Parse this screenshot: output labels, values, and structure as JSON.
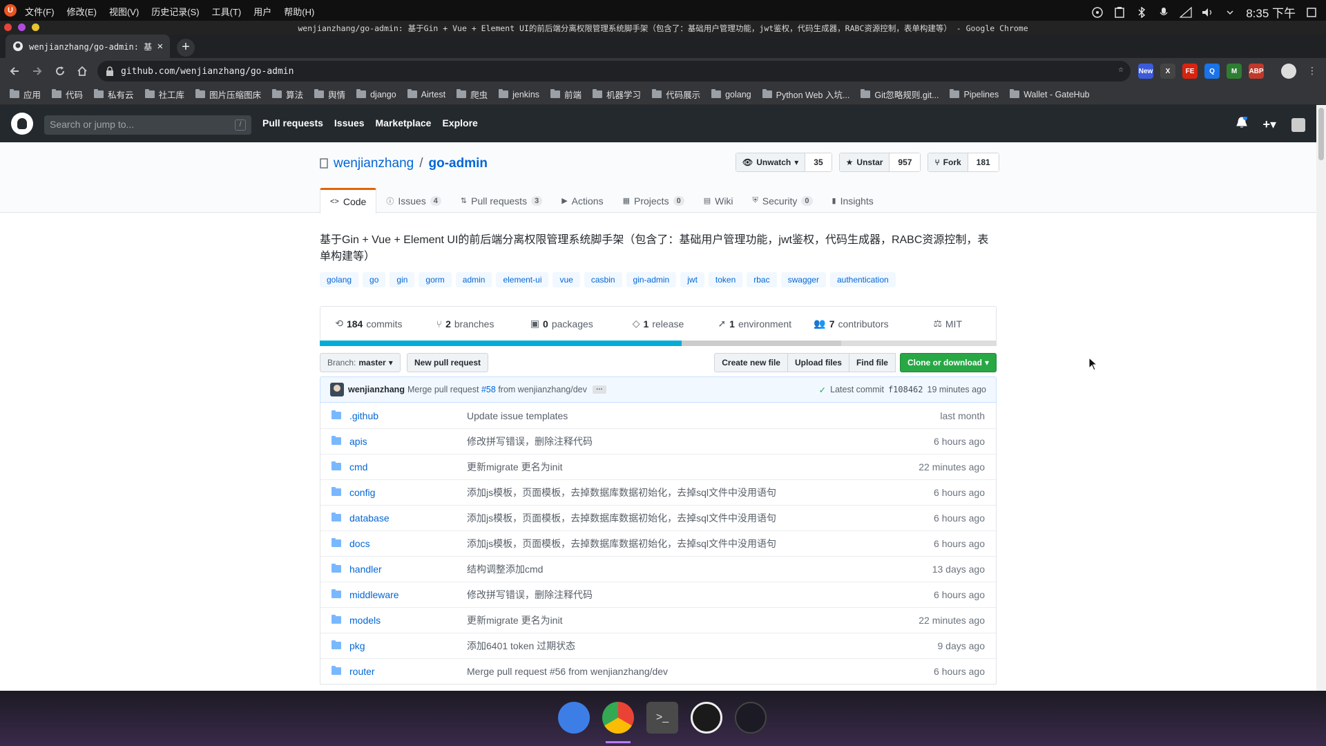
{
  "os": {
    "logo": "U",
    "menus": [
      "文件(F)",
      "修改(E)",
      "视图(V)",
      "历史记录(S)",
      "工具(T)",
      "用户",
      "帮助(H)"
    ],
    "clock": "8:35 下午"
  },
  "window": {
    "title": "wenjianzhang/go-admin: 基于Gin + Vue + Element UI的前后端分离权限管理系统脚手架（包含了：基础用户管理功能，jwt鉴权，代码生成器，RABC资源控制，表单构建等） - Google Chrome"
  },
  "browser": {
    "tab_title": "wenjianzhang/go-admin: 基",
    "url": "github.com/wenjianzhang/go-admin",
    "extensions": [
      {
        "label": "New",
        "color": "#3b5bdb"
      },
      {
        "label": "X",
        "color": "#444"
      },
      {
        "label": "FE",
        "color": "#d9230f"
      },
      {
        "label": "Q",
        "color": "#1a73e8"
      },
      {
        "label": "M",
        "color": "#2e7d32"
      },
      {
        "label": "ABP",
        "color": "#c0392b"
      }
    ],
    "bookmarks": [
      "应用",
      "代码",
      "私有云",
      "社工库",
      "图片压缩图床",
      "算法",
      "舆情",
      "django",
      "Airtest",
      "爬虫",
      "jenkins",
      "前端",
      "机器学习",
      "代码展示",
      "golang",
      "Python Web 入坑...",
      "Git忽略规则.git...",
      "Pipelines",
      "Wallet - GateHub"
    ]
  },
  "github": {
    "search_placeholder": "Search or jump to...",
    "search_key": "/",
    "nav": [
      "Pull requests",
      "Issues",
      "Marketplace",
      "Explore"
    ],
    "owner": "wenjianzhang",
    "repo": "go-admin",
    "watch": {
      "label": "Unwatch",
      "count": "35"
    },
    "star": {
      "label": "Unstar",
      "count": "957"
    },
    "fork": {
      "label": "Fork",
      "count": "181"
    },
    "tabs": [
      {
        "label": "Code",
        "count": ""
      },
      {
        "label": "Issues",
        "count": "4"
      },
      {
        "label": "Pull requests",
        "count": "3"
      },
      {
        "label": "Actions",
        "count": ""
      },
      {
        "label": "Projects",
        "count": "0"
      },
      {
        "label": "Wiki",
        "count": ""
      },
      {
        "label": "Security",
        "count": "0"
      },
      {
        "label": "Insights",
        "count": ""
      }
    ],
    "description": "基于Gin + Vue + Element UI的前后端分离权限管理系统脚手架（包含了：基础用户管理功能，jwt鉴权，代码生成器，RABC资源控制，表单构建等）",
    "topics": [
      "golang",
      "go",
      "gin",
      "gorm",
      "admin",
      "element-ui",
      "vue",
      "casbin",
      "gin-admin",
      "jwt",
      "token",
      "rbac",
      "swagger",
      "authentication"
    ],
    "summary": {
      "commits": "184",
      "commits_label": "commits",
      "branches": "2",
      "branches_label": "branches",
      "packages": "0",
      "packages_label": "packages",
      "releases": "1",
      "releases_label": "release",
      "environments": "1",
      "environments_label": "environment",
      "contributors": "7",
      "contributors_label": "contributors",
      "license": "MIT"
    },
    "language_bar": [
      {
        "share": 0.535,
        "color": "#00ADD8"
      },
      {
        "share": 0.235,
        "color": "#cccccc"
      },
      {
        "share": 0.23,
        "color": "#dddddd"
      }
    ],
    "branch_label": "Branch:",
    "branch": "master",
    "new_pr": "New pull request",
    "file_buttons": [
      "Create new file",
      "Upload files",
      "Find file"
    ],
    "clone_label": "Clone or download",
    "commit": {
      "author": "wenjianzhang",
      "message_prefix": "Merge pull request",
      "pr": "#58",
      "message_suffix": "from wenjianzhang/dev",
      "latest_label": "Latest commit",
      "sha": "f108462",
      "age": "19 minutes ago"
    },
    "files": [
      {
        "name": ".github",
        "msg": "Update issue templates",
        "age": "last month"
      },
      {
        "name": "apis",
        "msg": "修改拼写错误，删除注释代码",
        "age": "6 hours ago"
      },
      {
        "name": "cmd",
        "msg": "更新migrate 更名为init",
        "age": "22 minutes ago"
      },
      {
        "name": "config",
        "msg": "添加js模板，页面模板，去掉数据库数据初始化，去掉sql文件中没用语句",
        "age": "6 hours ago"
      },
      {
        "name": "database",
        "msg": "添加js模板，页面模板，去掉数据库数据初始化，去掉sql文件中没用语句",
        "age": "6 hours ago"
      },
      {
        "name": "docs",
        "msg": "添加js模板，页面模板，去掉数据库数据初始化，去掉sql文件中没用语句",
        "age": "6 hours ago"
      },
      {
        "name": "handler",
        "msg": "结构调整添加cmd",
        "age": "13 days ago"
      },
      {
        "name": "middleware",
        "msg": "修改拼写错误，删除注释代码",
        "age": "6 hours ago"
      },
      {
        "name": "models",
        "msg": "更新migrate 更名为init",
        "age": "22 minutes ago"
      },
      {
        "name": "pkg",
        "msg": "添加6401 token 过期状态",
        "age": "9 days ago"
      },
      {
        "name": "router",
        "msg": "Merge pull request #56 from wenjianzhang/dev",
        "age": "6 hours ago"
      }
    ]
  },
  "dock": [
    {
      "name": "files-app-icon",
      "color": "#3d7ee6"
    },
    {
      "name": "chrome-app-icon",
      "color": "#ffffff"
    },
    {
      "name": "terminal-app-icon",
      "color": "#4a4a4a"
    },
    {
      "name": "obs-app-icon",
      "color": "#1a1a1a"
    },
    {
      "name": "clock-app-icon",
      "color": "#1c1a24"
    }
  ]
}
